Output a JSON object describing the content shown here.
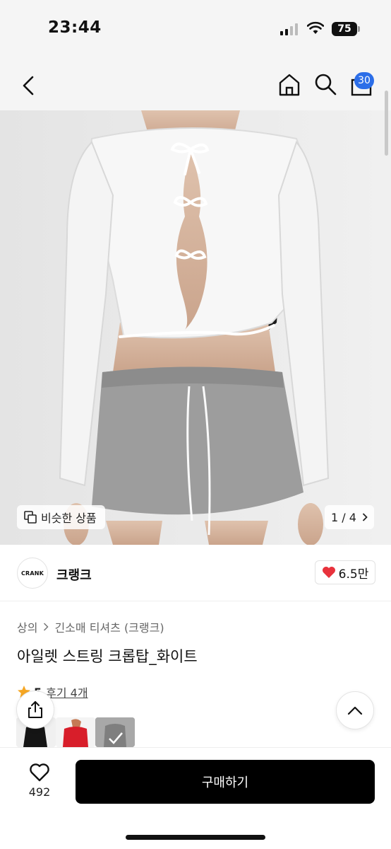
{
  "status_bar": {
    "time": "23:44",
    "battery": "75"
  },
  "nav": {
    "cart_count": "30"
  },
  "gallery": {
    "similar_label": "비슷한 상품",
    "page_indicator": "1 / 4"
  },
  "shop": {
    "logo_text": "CRANK",
    "name": "크랭크",
    "likes": "6.5만"
  },
  "breadcrumb": {
    "category": "상의",
    "subcategory": "긴소매 티셔츠 (크랭크)"
  },
  "product": {
    "title": "아일렛 스트링 크롭탑_화이트"
  },
  "rating": {
    "score": "5",
    "reviews_label": "후기 4개"
  },
  "bottom": {
    "wish_count": "492",
    "buy_label": "구매하기"
  },
  "colors": {
    "accent_badge": "#2c6ee8",
    "heart": "#e8323c",
    "star": "#f5a623"
  }
}
